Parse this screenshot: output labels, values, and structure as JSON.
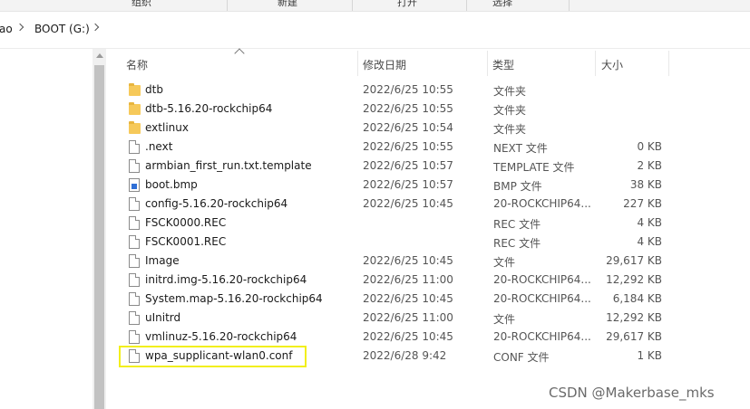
{
  "ribbon": {
    "groups": [
      "组织",
      "新建",
      "打开",
      "选择"
    ]
  },
  "address": {
    "crumbs": [
      "ao",
      "BOOT (G:)"
    ]
  },
  "columns": {
    "name": "名称",
    "date": "修改日期",
    "type": "类型",
    "size": "大小"
  },
  "files": [
    {
      "name": "dtb",
      "date": "2022/6/25 10:55",
      "type": "文件夹",
      "size": "",
      "icon": "folder-icon"
    },
    {
      "name": "dtb-5.16.20-rockchip64",
      "date": "2022/6/25 10:55",
      "type": "文件夹",
      "size": "",
      "icon": "folder-icon"
    },
    {
      "name": "extlinux",
      "date": "2022/6/25 10:54",
      "type": "文件夹",
      "size": "",
      "icon": "folder-icon"
    },
    {
      "name": ".next",
      "date": "2022/6/25 10:55",
      "type": "NEXT 文件",
      "size": "0 KB",
      "icon": "file-icon"
    },
    {
      "name": "armbian_first_run.txt.template",
      "date": "2022/6/25 10:57",
      "type": "TEMPLATE 文件",
      "size": "2 KB",
      "icon": "file-icon"
    },
    {
      "name": "boot.bmp",
      "date": "2022/6/25 10:57",
      "type": "BMP 文件",
      "size": "38 KB",
      "icon": "bitmap-icon"
    },
    {
      "name": "config-5.16.20-rockchip64",
      "date": "2022/6/25 10:45",
      "type": "20-ROCKCHIP64...",
      "size": "227 KB",
      "icon": "file-icon"
    },
    {
      "name": "FSCK0000.REC",
      "date": "",
      "type": "REC 文件",
      "size": "4 KB",
      "icon": "file-icon"
    },
    {
      "name": "FSCK0001.REC",
      "date": "",
      "type": "REC 文件",
      "size": "4 KB",
      "icon": "file-icon"
    },
    {
      "name": "Image",
      "date": "2022/6/25 10:45",
      "type": "文件",
      "size": "29,617 KB",
      "icon": "file-icon"
    },
    {
      "name": "initrd.img-5.16.20-rockchip64",
      "date": "2022/6/25 11:00",
      "type": "20-ROCKCHIP64...",
      "size": "12,292 KB",
      "icon": "file-icon"
    },
    {
      "name": "System.map-5.16.20-rockchip64",
      "date": "2022/6/25 10:45",
      "type": "20-ROCKCHIP64...",
      "size": "6,184 KB",
      "icon": "file-icon"
    },
    {
      "name": "uInitrd",
      "date": "2022/6/25 11:00",
      "type": "文件",
      "size": "12,292 KB",
      "icon": "file-icon"
    },
    {
      "name": "vmlinuz-5.16.20-rockchip64",
      "date": "2022/6/25 10:45",
      "type": "20-ROCKCHIP64...",
      "size": "29,617 KB",
      "icon": "file-icon"
    },
    {
      "name": "wpa_supplicant-wlan0.conf",
      "date": "2022/6/28 9:42",
      "type": "CONF 文件",
      "size": "1 KB",
      "icon": "file-icon"
    }
  ],
  "watermark": "CSDN @Makerbase_mks",
  "colors": {
    "highlight": "#f2ef1b",
    "folder": "#f6c95a"
  }
}
